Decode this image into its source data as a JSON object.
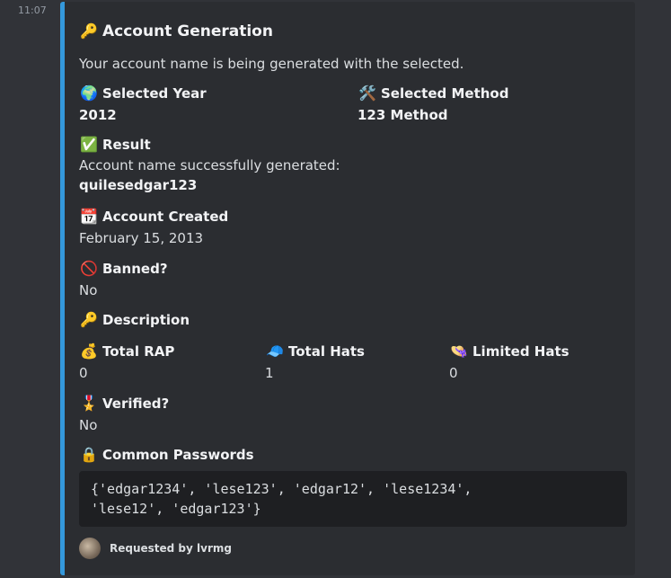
{
  "timestamp": "11:07",
  "embed": {
    "accent": "#3498db",
    "title_icon": "🔑",
    "title": "Account Generation",
    "description": "Your account name is being generated with the selected.",
    "fields": {
      "selected_year": {
        "icon": "🌍",
        "name": "Selected Year",
        "value": "2012"
      },
      "selected_method": {
        "icon": "🛠️",
        "name": "Selected Method",
        "value": "123 Method"
      },
      "result": {
        "icon": "✅",
        "name": "Result",
        "line1": "Account name successfully generated:",
        "value": "quilesedgar123"
      },
      "account_created": {
        "icon": "📆",
        "name": "Account Created",
        "value": "February 15, 2013"
      },
      "banned": {
        "icon": "🚫",
        "name": "Banned?",
        "value": "No"
      },
      "description": {
        "icon": "🔑",
        "name": "Description"
      },
      "total_rap": {
        "icon": "💰",
        "name": "Total RAP",
        "value": "0"
      },
      "total_hats": {
        "icon": "🧢",
        "name": "Total Hats",
        "value": "1"
      },
      "limited_hats": {
        "icon": "👒",
        "name": "Limited Hats",
        "value": "0"
      },
      "verified": {
        "icon": "🎖️",
        "name": "Verified?",
        "value": "No"
      },
      "common_passwords": {
        "icon": "🔒",
        "name": "Common Passwords",
        "line1": "{'edgar1234', 'lese123', 'edgar12', 'lese1234',",
        "line2": "'lese12', 'edgar123'}"
      }
    },
    "footer": {
      "text": "Requested by lvrmg"
    }
  }
}
